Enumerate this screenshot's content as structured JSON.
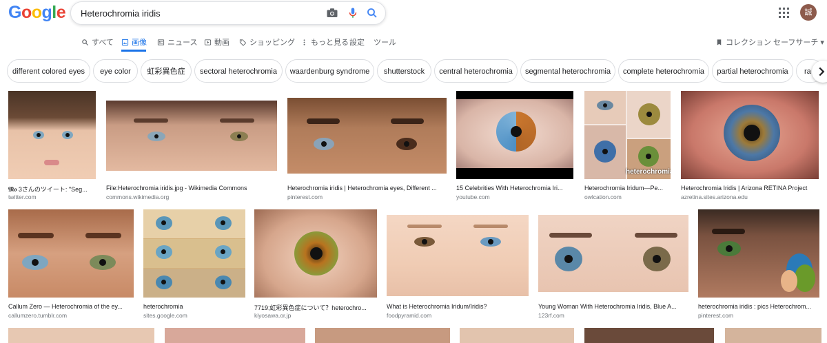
{
  "logo": {
    "text": "Google"
  },
  "search": {
    "query": "Heterochromia iridis"
  },
  "account": {
    "avatar_initial": "誠"
  },
  "tabs": [
    {
      "label": "すべて"
    },
    {
      "label": "画像"
    },
    {
      "label": "ニュース"
    },
    {
      "label": "動画"
    },
    {
      "label": "ショッピング"
    },
    {
      "label": "もっと見る"
    },
    {
      "label": "設定"
    },
    {
      "label": "ツール"
    }
  ],
  "right_tools": {
    "collections": "コレクション",
    "safesearch": "セーフサーチ ▾"
  },
  "chips": [
    "different colored eyes",
    "eye color",
    "虹彩異色症",
    "sectoral heterochromia",
    "waardenburg syndrome",
    "shutterstock",
    "central heterochromia",
    "segmental heterochromia",
    "complete heterochromia",
    "partial heterochromia",
    "ra"
  ],
  "results_row1": [
    {
      "caption": "𝕸𝖔 3さんのツイート: \"Seg...",
      "source": "twitter.com"
    },
    {
      "caption": "File:Heterochromia iridis.jpg - Wikimedia Commons",
      "source": "commons.wikimedia.org"
    },
    {
      "caption": "Heterochromia iridis | Heterochromia eyes, Different ...",
      "source": "pinterest.com"
    },
    {
      "caption": "15 Celebrities With Heterochromia Iri...",
      "source": "youtube.com"
    },
    {
      "caption": "Heterochromia Iridum—Pe...",
      "source": "owlcation.com",
      "overlay": "heterochromia"
    },
    {
      "caption": "Heterochromia Iridis | Arizona RETINA Project",
      "source": "azretina.sites.arizona.edu"
    }
  ],
  "results_row2": [
    {
      "caption": "Callum Zero — Heterochromia of the ey...",
      "source": "callumzero.tumblr.com"
    },
    {
      "caption": "heterochromia",
      "source": "sites.google.com"
    },
    {
      "caption": "7719;虹彩異色症について？heterochro...",
      "source": "kiyosawa.or.jp"
    },
    {
      "caption": "What is Heterochromia Iridum/Iridis?",
      "source": "foodpyramid.com"
    },
    {
      "caption": "Young Woman With Heterochromia Iridis, Blue A...",
      "source": "123rf.com"
    },
    {
      "caption": "heterochromia iridis : pics Heterochrom...",
      "source": "pinterest.com"
    }
  ]
}
